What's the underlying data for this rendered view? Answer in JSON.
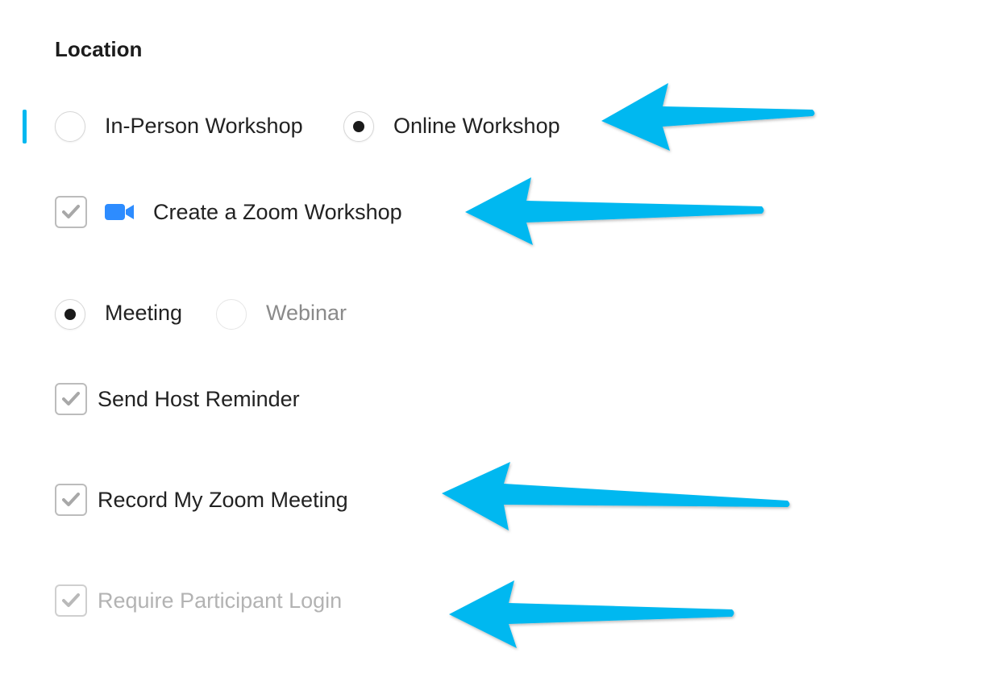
{
  "section": {
    "title": "Location"
  },
  "location_type": {
    "options": [
      {
        "label": "In-Person Workshop",
        "selected": false
      },
      {
        "label": "Online Workshop",
        "selected": true
      }
    ]
  },
  "zoom": {
    "create_label": "Create a Zoom Workshop",
    "create_checked": true,
    "icon": "zoom-video-camera-icon",
    "icon_color": "#2D8CFF"
  },
  "zoom_type": {
    "options": [
      {
        "label": "Meeting",
        "selected": true,
        "disabled": false
      },
      {
        "label": "Webinar",
        "selected": false,
        "disabled": true
      }
    ]
  },
  "settings": [
    {
      "label": "Send Host Reminder",
      "checked": true,
      "disabled": false
    },
    {
      "label": "Record My Zoom Meeting",
      "checked": true,
      "disabled": false
    },
    {
      "label": "Require Participant Login",
      "checked": true,
      "disabled": true
    }
  ],
  "colors": {
    "accent": "#00B8F0",
    "annotation_arrow": "#00B8F0",
    "check_mark": "#a8a8a8"
  }
}
